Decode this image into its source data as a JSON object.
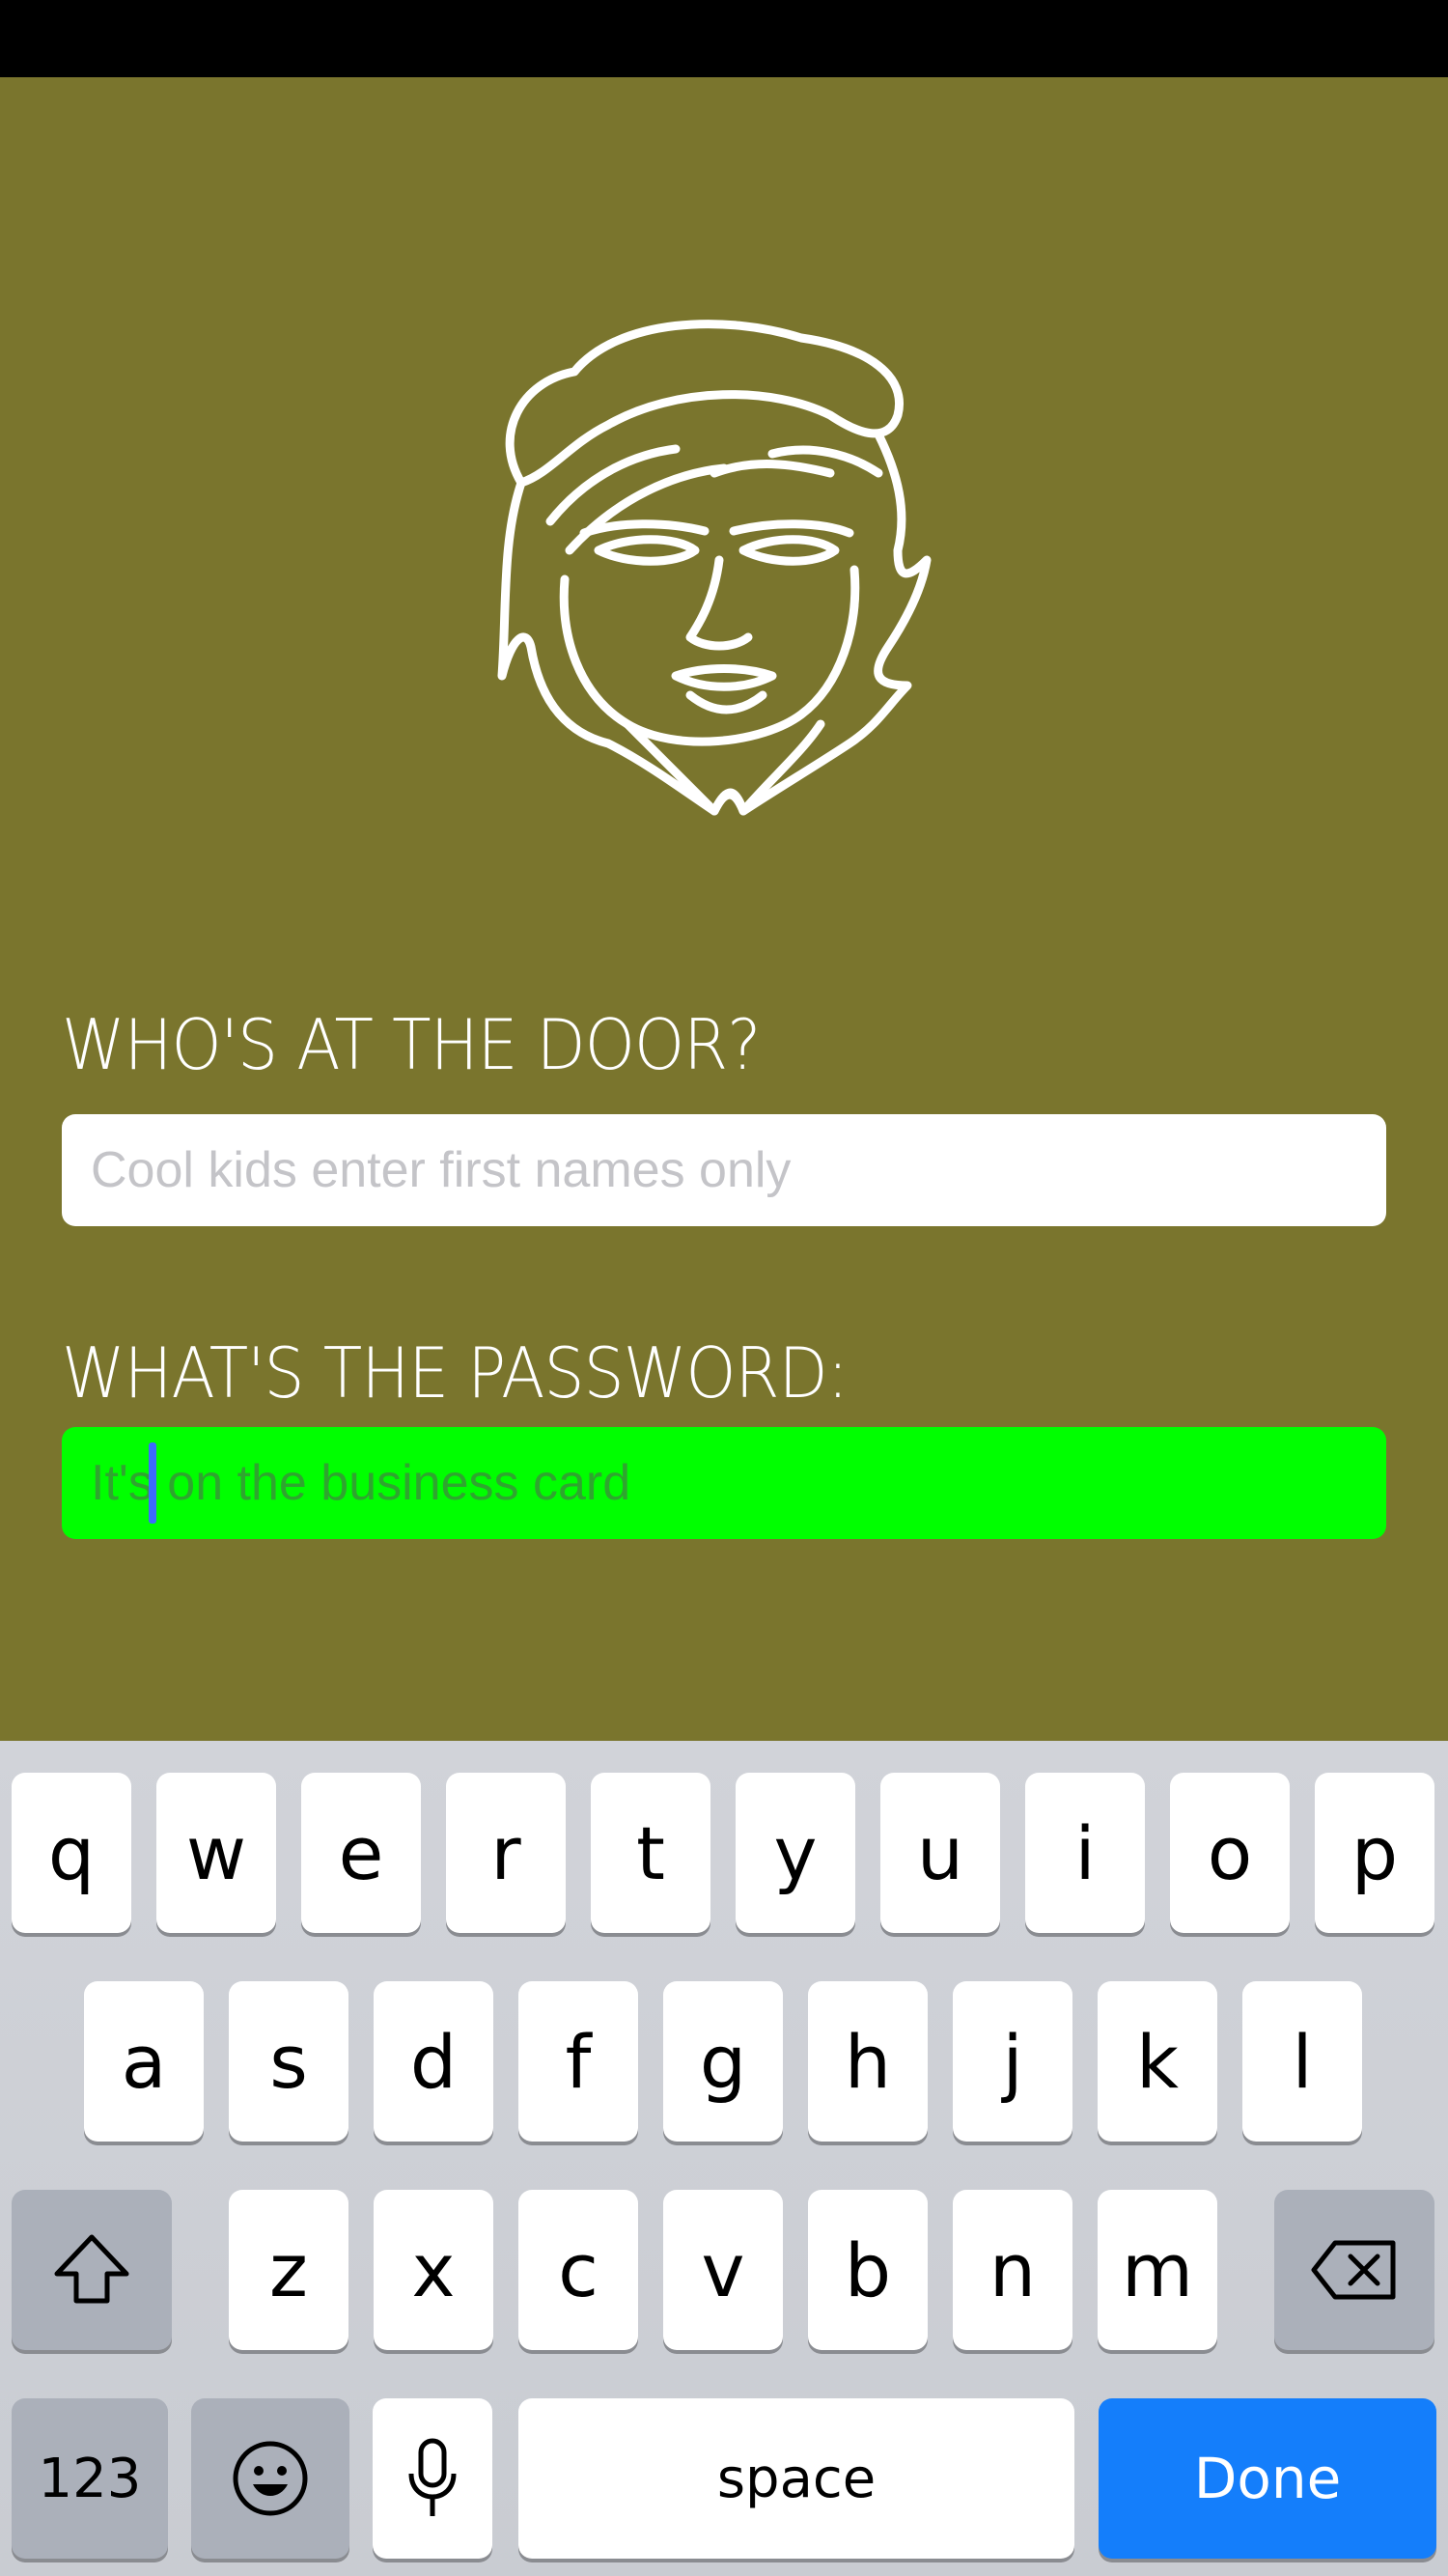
{
  "colors": {
    "background": "#7a752d",
    "password_field_bg": "#00ff00",
    "done_key": "#147efb"
  },
  "labels": {
    "who": "WHO'S AT THE DOOR?",
    "password": "WHAT'S THE PASSWORD:"
  },
  "fields": {
    "name_placeholder": "Cool kids enter first names only",
    "password_placeholder": "It's on the business card"
  },
  "keyboard": {
    "row1": [
      "q",
      "w",
      "e",
      "r",
      "t",
      "y",
      "u",
      "i",
      "o",
      "p"
    ],
    "row2": [
      "a",
      "s",
      "d",
      "f",
      "g",
      "h",
      "j",
      "k",
      "l"
    ],
    "row3": [
      "z",
      "x",
      "c",
      "v",
      "b",
      "n",
      "m"
    ],
    "numbers": "123",
    "space": "space",
    "done": "Done",
    "shift_icon": "shift-icon",
    "backspace_icon": "backspace-icon",
    "emoji_icon": "emoji-icon",
    "mic_icon": "microphone-icon"
  }
}
